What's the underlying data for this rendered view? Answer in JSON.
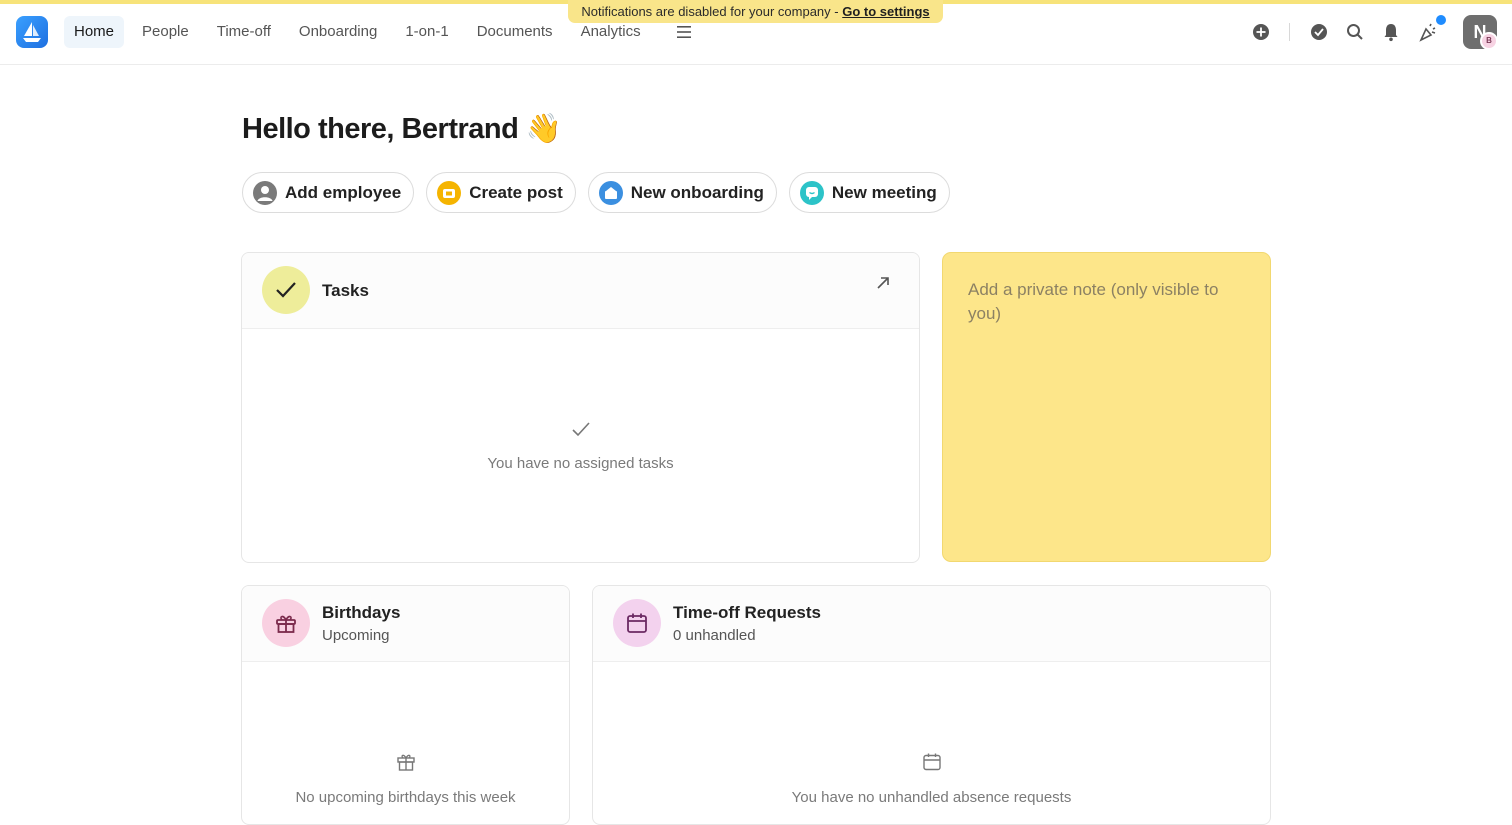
{
  "banner": {
    "text": "Notifications are disabled for your company - ",
    "link": "Go to settings"
  },
  "nav": {
    "items": [
      "Home",
      "People",
      "Time-off",
      "Onboarding",
      "1-on-1",
      "Documents",
      "Analytics"
    ],
    "active": "Home"
  },
  "user": {
    "avatar_letter": "N",
    "badge_letter": "B"
  },
  "greeting": "Hello there, Bertrand 👋",
  "actions": [
    {
      "label": "Add employee",
      "icon": "person-icon",
      "color": "#7a7a7a"
    },
    {
      "label": "Create post",
      "icon": "megaphone-icon",
      "color": "#f5b400"
    },
    {
      "label": "New onboarding",
      "icon": "onboarding-icon",
      "color": "#3b8fe0"
    },
    {
      "label": "New meeting",
      "icon": "chat-icon",
      "color": "#2cc3c8"
    }
  ],
  "tasks": {
    "title": "Tasks",
    "empty": "You have no assigned tasks",
    "icon_bg": "#eeed9a"
  },
  "note": {
    "placeholder": "Add a private note (only visible to you)",
    "bg": "#fde68a"
  },
  "birthdays": {
    "title": "Birthdays",
    "subtitle": "Upcoming",
    "empty": "No upcoming birthdays this week",
    "icon_bg": "#f9d0e1"
  },
  "timeoff": {
    "title": "Time-off Requests",
    "subtitle": "0 unhandled",
    "empty": "You have no unhandled absence requests",
    "icon_bg": "#f3d2ee"
  }
}
